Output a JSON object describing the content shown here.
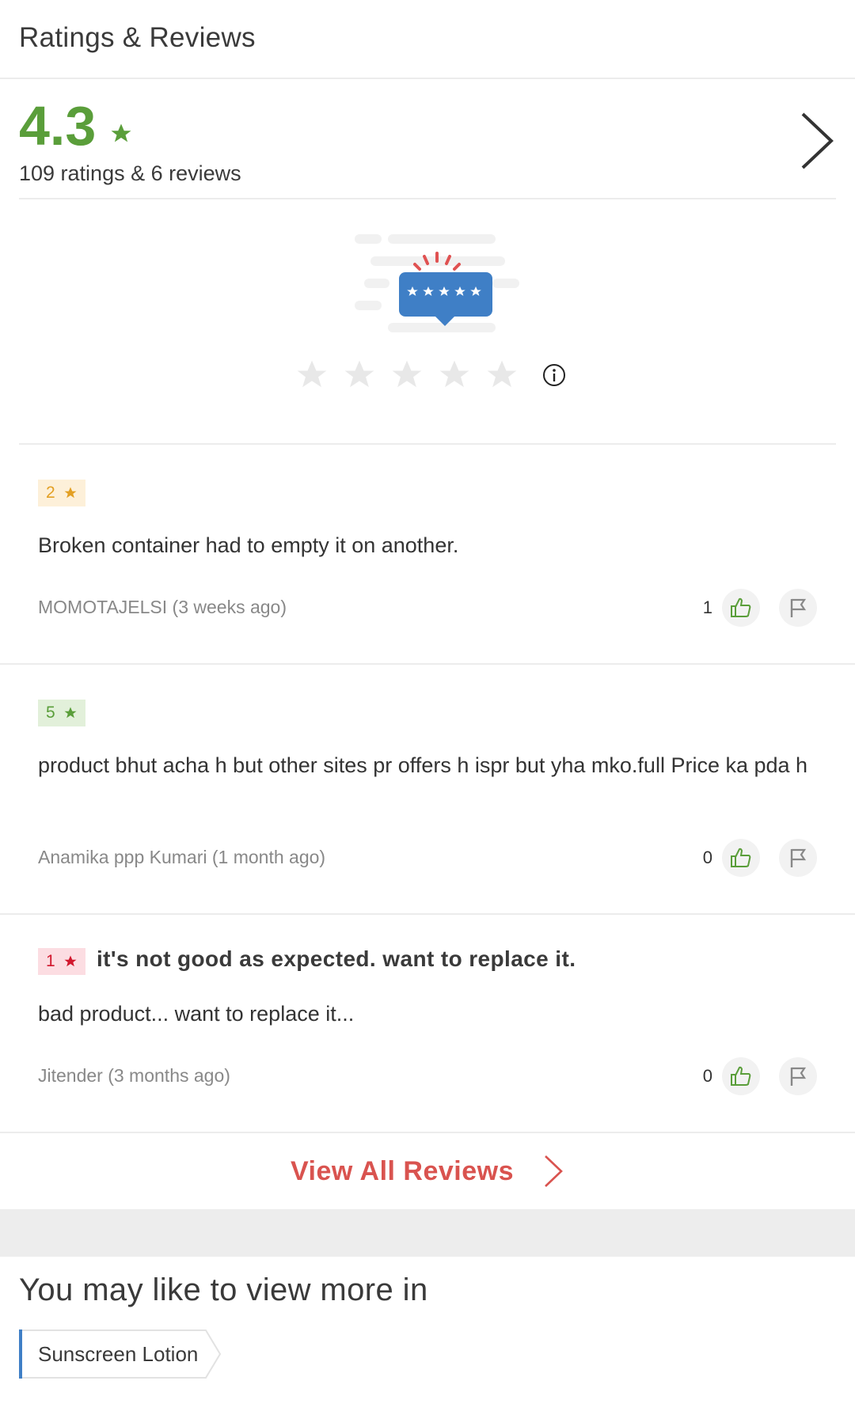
{
  "header": {
    "title": "Ratings & Reviews"
  },
  "summary": {
    "score": "4.3",
    "counts": "109 ratings & 6 reviews",
    "accent": "#5a9e3a"
  },
  "rate_prompt": {
    "stars": 5,
    "illustration_stars": 5
  },
  "reviews": [
    {
      "rating": "2",
      "rating_color": "orange",
      "title": "",
      "body": "Broken container had to empty it on another.",
      "author": "MOMOTAJELSI (3 weeks ago)",
      "likes": "1"
    },
    {
      "rating": "5",
      "rating_color": "green",
      "title": "",
      "body": "product bhut acha h but other sites pr offers h ispr but yha mko.full Price ka pda h",
      "author": "Anamika ppp Kumari (1 month ago)",
      "likes": "0"
    },
    {
      "rating": "1",
      "rating_color": "red",
      "title": "it's not good  as expected. want to replace  it.",
      "body": "bad product... want to replace it...",
      "author": "Jitender (3 months ago)",
      "likes": "0"
    }
  ],
  "view_all": {
    "label": "View All Reviews",
    "color": "#d9534f"
  },
  "more": {
    "heading": "You may like to view more in",
    "tags": [
      "Sunscreen Lotion"
    ]
  }
}
